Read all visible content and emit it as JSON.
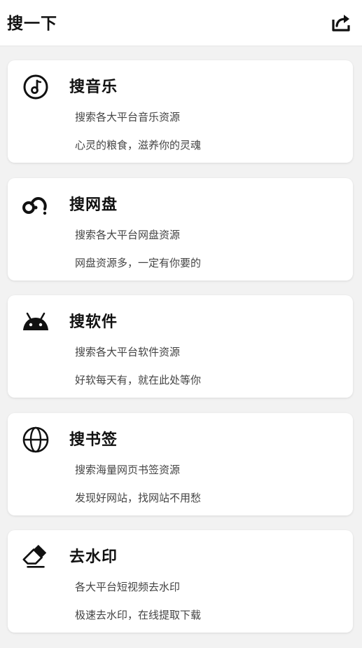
{
  "header": {
    "title": "搜一下",
    "share_icon": "share-icon"
  },
  "cards": [
    {
      "icon": "music-disc-icon",
      "title": "搜音乐",
      "line1": "搜索各大平台音乐资源",
      "line2": "心灵的粮食，滋养你的灵魂"
    },
    {
      "icon": "netdisk-icon",
      "title": "搜网盘",
      "line1": "搜索各大平台网盘资源",
      "line2": "网盘资源多，一定有你要的"
    },
    {
      "icon": "android-icon",
      "title": "搜软件",
      "line1": "搜索各大平台软件资源",
      "line2": "好软每天有，就在此处等你"
    },
    {
      "icon": "globe-icon",
      "title": "搜书签",
      "line1": "搜索海量网页书签资源",
      "line2": "发现好网站，找网站不用愁"
    },
    {
      "icon": "eraser-icon",
      "title": "去水印",
      "line1": "各大平台短视频去水印",
      "line2": "极速去水印，在线提取下载"
    }
  ]
}
